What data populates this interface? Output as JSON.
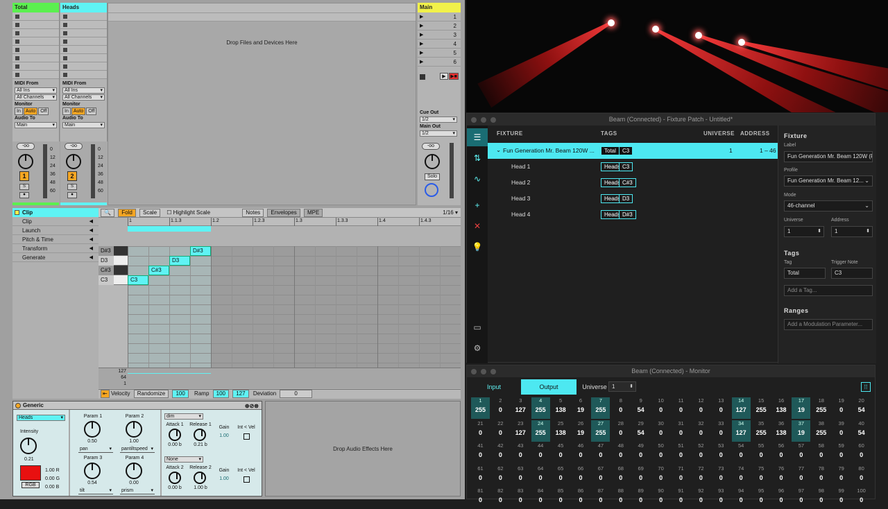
{
  "ableton": {
    "tracks": [
      {
        "name": "Total",
        "color": "#5bf04f",
        "midi_from_label": "MIDI From",
        "midi_from": "All Ins",
        "channels": "All Channels",
        "monitor_label": "Monitor",
        "mon_in": "In",
        "mon_auto": "Auto",
        "mon_off": "Off",
        "audio_to_label": "Audio To",
        "audio_to": "Main",
        "vol": "-oo",
        "num": "1",
        "solo": "S",
        "scale": [
          "0",
          "12",
          "24",
          "36",
          "48",
          "60"
        ]
      },
      {
        "name": "Heads",
        "color": "#5ff3f4",
        "midi_from_label": "MIDI From",
        "midi_from": "All Ins",
        "channels": "All Channels",
        "monitor_label": "Monitor",
        "mon_in": "In",
        "mon_auto": "Auto",
        "mon_off": "Off",
        "audio_to_label": "Audio To",
        "audio_to": "Main",
        "vol": "-oo",
        "num": "2",
        "solo": "S",
        "scale": [
          "0",
          "12",
          "24",
          "36",
          "48",
          "60"
        ]
      }
    ],
    "drop_files": "Drop Files and Devices Here",
    "master": {
      "name": "Main",
      "color": "#f1f14a",
      "scenes": [
        "1",
        "2",
        "3",
        "4",
        "5",
        "6"
      ],
      "cue_out_label": "Cue Out",
      "cue_out": "1/2",
      "main_out_label": "Main Out",
      "main_out": "1/2",
      "vol": "-oo",
      "solo": "Solo"
    },
    "clip": {
      "header": "Clip",
      "sections": [
        "Clip",
        "Launch",
        "Pitch & Time",
        "Transform",
        "Generate"
      ],
      "toolbar": {
        "fold": "Fold",
        "scale": "Scale",
        "highlight": "Highlight Scale",
        "notes": "Notes",
        "envelopes": "Envelopes",
        "mpe": "MPE",
        "grid": "1/16 ▾"
      },
      "ruler": [
        "1",
        "1.1.3",
        "1.2",
        "1.2.3",
        "1.3",
        "1.3.3",
        "1.4",
        "1.4.3"
      ],
      "keys": [
        "D#3",
        "D3",
        "C#3",
        "C3"
      ],
      "notes": [
        "C3",
        "C#3",
        "D3",
        "D#3"
      ],
      "velocity_scale": [
        "127",
        "64",
        "1"
      ],
      "bottom": {
        "velocity": "Velocity",
        "randomize": "Randomize",
        "vel_val": "100",
        "ramp": "Ramp",
        "ramp_a": "100",
        "ramp_b": "127",
        "deviation": "Deviation",
        "dev_val": "0"
      }
    },
    "device": {
      "name": "Generic",
      "target": "Heads",
      "intensity_label": "Intensity",
      "intensity": "0.21",
      "rgb_label": "RGB",
      "rgb_values": [
        "1.00 R",
        "0.00 G",
        "0.00 B"
      ],
      "rgb_color": "#e81010",
      "params": [
        {
          "label": "Param 1",
          "value": "0.50",
          "map": "pan"
        },
        {
          "label": "Param 2",
          "value": "1.00",
          "map": "pantiltspeed"
        },
        {
          "label": "Param 3",
          "value": "0.54",
          "map": "tilt"
        },
        {
          "label": "Param 4",
          "value": "0.00",
          "map": "prism"
        }
      ],
      "env1": {
        "target": "dim",
        "attack_label": "Attack 1",
        "attack": "0.00 b",
        "release_label": "Release 1",
        "release": "0.21 b",
        "gain_label": "Gain",
        "gain": "1.00",
        "intvel": "Int < Vel"
      },
      "env2": {
        "target": "None",
        "attack_label": "Attack 2",
        "attack": "0.00 b",
        "release_label": "Release 2",
        "release": "1.00 b",
        "gain_label": "Gain",
        "gain": "1.00",
        "intvel": "Int < Vel"
      }
    },
    "drop_effects": "Drop Audio Effects Here"
  },
  "patch": {
    "title": "Beam (Connected) - Fixture Patch - Untitled*",
    "columns": {
      "fixture": "FIXTURE",
      "tags": "TAGS",
      "universe": "UNIVERSE",
      "address": "ADDRESS"
    },
    "rows": [
      {
        "name": "Fun Generation Mr. Beam 120W ...",
        "tags": [
          "Total",
          "C3"
        ],
        "universe": "1",
        "address": "1 – 46"
      },
      {
        "name": "Head 1",
        "tags": [
          "Heads",
          "C3"
        ],
        "universe": "",
        "address": ""
      },
      {
        "name": "Head 2",
        "tags": [
          "Heads",
          "C#3"
        ],
        "universe": "",
        "address": ""
      },
      {
        "name": "Head 3",
        "tags": [
          "Heads",
          "D3"
        ],
        "universe": "",
        "address": ""
      },
      {
        "name": "Head 4",
        "tags": [
          "Heads",
          "D#3"
        ],
        "universe": "",
        "address": ""
      }
    ],
    "inspector": {
      "section": "Fixture",
      "label_label": "Label",
      "label": "Fun Generation Mr. Beam 120W (R",
      "profile_label": "Profile",
      "profile": "Fun Generation Mr. Beam 12...",
      "mode_label": "Mode",
      "mode": "46-channel",
      "universe_label": "Universe",
      "universe": "1",
      "address_label": "Address",
      "address": "1",
      "tags_section": "Tags",
      "tag_label": "Tag",
      "tag": "Total",
      "trigger_label": "Trigger Note",
      "trigger": "C3",
      "add_tag": "Add a Tag...",
      "ranges_section": "Ranges",
      "add_mod": "Add a Modulation Parameter..."
    }
  },
  "monitor": {
    "title": "Beam (Connected) - Monitor",
    "tab_input": "Input",
    "tab_output": "Output",
    "universe_label": "Universe",
    "universe": "1",
    "values": [
      255,
      0,
      127,
      255,
      138,
      19,
      255,
      0,
      54,
      0,
      0,
      0,
      0,
      127,
      255,
      138,
      19,
      255,
      0,
      54,
      0,
      0,
      127,
      255,
      138,
      19,
      255,
      0,
      54,
      0,
      0,
      0,
      0,
      127,
      255,
      138,
      19,
      255,
      0,
      54,
      0,
      0,
      0,
      0,
      0,
      0,
      0,
      0,
      0,
      0,
      0,
      0,
      0,
      0,
      0,
      0,
      0,
      0,
      0,
      0,
      0,
      0,
      0,
      0,
      0,
      0,
      0,
      0,
      0,
      0,
      0,
      0,
      0,
      0,
      0,
      0,
      0,
      0,
      0,
      0,
      0,
      0,
      0,
      0,
      0,
      0,
      0,
      0,
      0,
      0,
      0,
      0,
      0,
      0,
      0,
      0,
      0,
      0,
      0,
      0
    ],
    "highlighted": [
      1,
      4,
      7,
      14,
      17,
      24,
      27,
      34,
      37
    ]
  }
}
